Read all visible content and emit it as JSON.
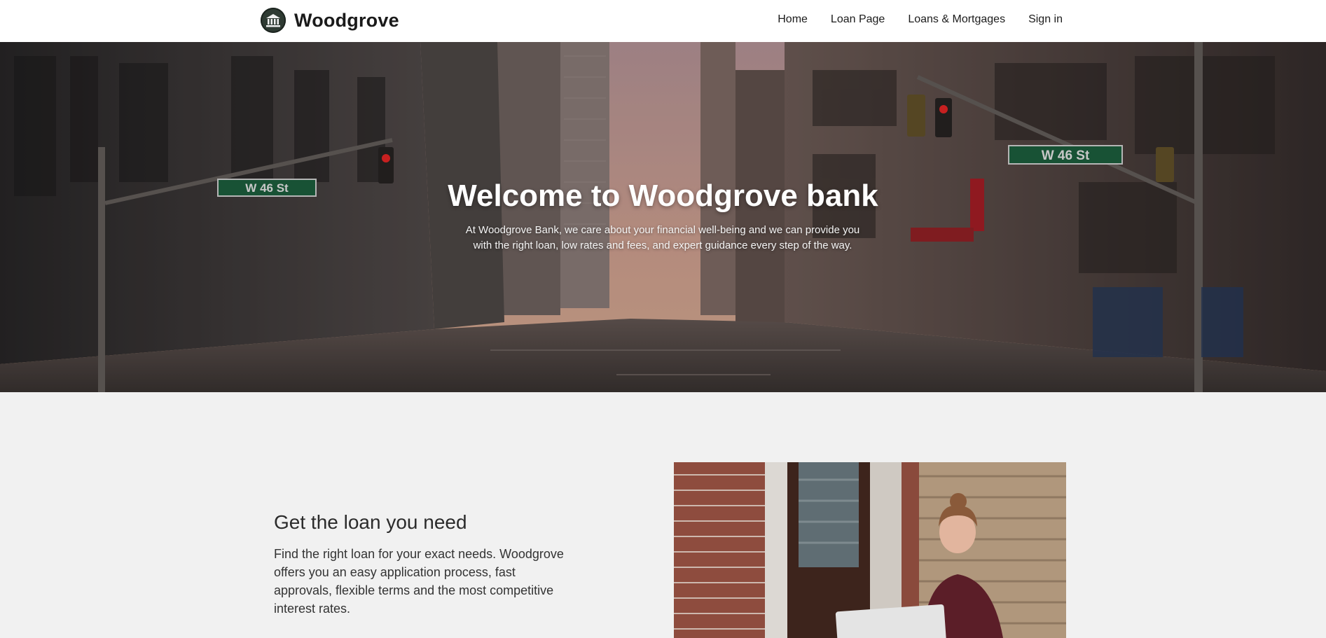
{
  "header": {
    "brand": "Woodgrove",
    "logo_icon": "bank-building-icon",
    "nav": [
      {
        "label": "Home"
      },
      {
        "label": "Loan Page"
      },
      {
        "label": "Loans & Mortgages"
      },
      {
        "label": "Sign in"
      }
    ]
  },
  "hero": {
    "title": "Welcome to Woodgrove bank",
    "subtitle": "At Woodgrove Bank, we care about your financial well-being and we can provide you with the right loan, low rates and fees, and expert guidance every step of the way.",
    "street_signs": [
      "W 46 St",
      "W 46 St"
    ]
  },
  "loan": {
    "heading": "Get the loan you need",
    "text": "Find the right loan for your exact needs. Woodgrove offers you an easy application process, fast approvals, flexible terms and the most competitive interest rates."
  }
}
